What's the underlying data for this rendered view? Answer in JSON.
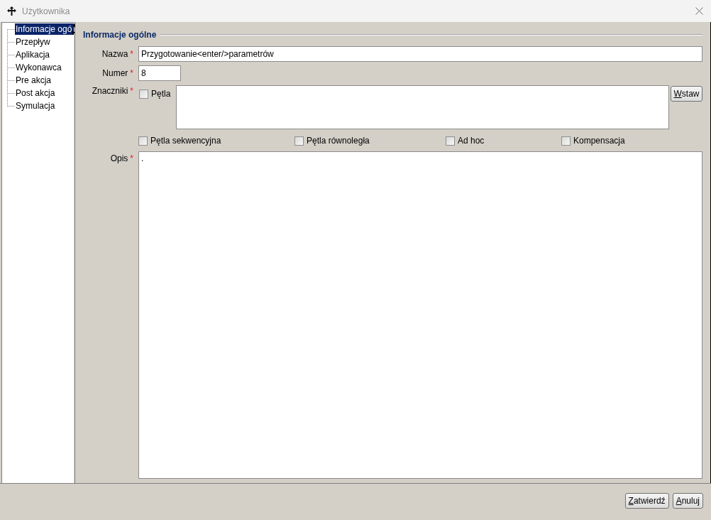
{
  "window": {
    "title": "Użytkownika"
  },
  "sidebar": {
    "items": [
      {
        "label": "Informacje ogó",
        "selected": true
      },
      {
        "label": "Przepływ",
        "selected": false
      },
      {
        "label": "Aplikacja",
        "selected": false
      },
      {
        "label": "Wykonawca",
        "selected": false
      },
      {
        "label": "Pre akcja",
        "selected": false
      },
      {
        "label": "Post akcja",
        "selected": false
      },
      {
        "label": "Symulacja",
        "selected": false
      }
    ]
  },
  "section": {
    "title": "Informacje ogólne"
  },
  "form": {
    "name": {
      "label": "Nazwa",
      "required_mark": "*",
      "value": "Przygotowanie<enter/>parametrów"
    },
    "number": {
      "label": "Numer",
      "required_mark": "*",
      "value": "8"
    },
    "tags": {
      "label": "Znaczniki",
      "required_mark": "*",
      "loop": {
        "label": "Pętla",
        "checked": false
      },
      "insert_button": "Wstaw",
      "options": [
        {
          "label": "Pętla sekwencyjna",
          "checked": false
        },
        {
          "label": "Pętla równoległa",
          "checked": false
        },
        {
          "label": "Ad hoc",
          "checked": false
        },
        {
          "label": "Kompensacja",
          "checked": false
        }
      ]
    },
    "description": {
      "label": "Opis",
      "required_mark": "*",
      "value": "."
    }
  },
  "buttons": [
    "Zatwierdź",
    "Anuluj"
  ]
}
